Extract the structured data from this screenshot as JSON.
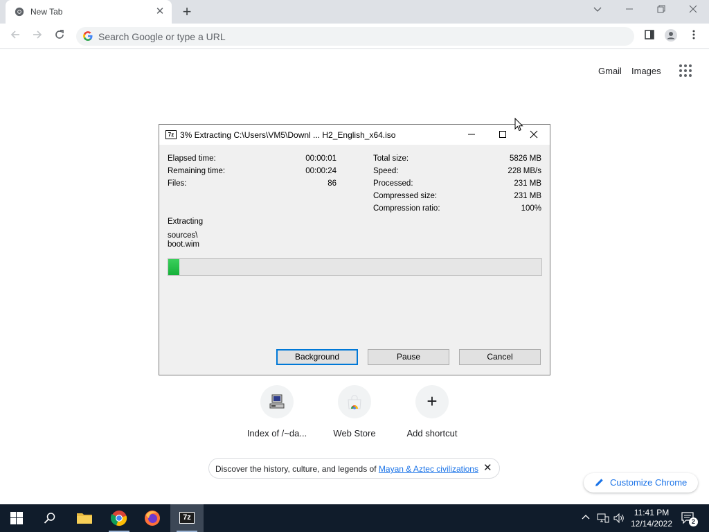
{
  "browser": {
    "tab_title": "New Tab",
    "tab_close": "✕",
    "new_tab": "+",
    "omnibox_placeholder": "Search Google or type a URL",
    "gmail": "Gmail",
    "images": "Images"
  },
  "shortcuts": [
    {
      "label": "Index of /~da..."
    },
    {
      "label": "Web Store"
    },
    {
      "label": "Add shortcut",
      "glyph": "+"
    }
  ],
  "promo": {
    "text": "Discover the history, culture, and legends of ",
    "link": "Mayan & Aztec civilizations",
    "close": "✕"
  },
  "customize": {
    "label": "Customize Chrome"
  },
  "dialog": {
    "icon": "7z",
    "title": "3% Extracting C:\\Users\\VM5\\Downl ... H2_English_x64.iso",
    "progress_fraction": 0.03,
    "stats_left": [
      {
        "label": "Elapsed time:",
        "value": "00:00:01"
      },
      {
        "label": "Remaining time:",
        "value": "00:00:24"
      },
      {
        "label": "Files:",
        "value": "86"
      }
    ],
    "stats_right": [
      {
        "label": "Total size:",
        "value": "5826 MB"
      },
      {
        "label": "Speed:",
        "value": "228 MB/s"
      },
      {
        "label": "Processed:",
        "value": "231 MB"
      },
      {
        "label": "Compressed size:",
        "value": "231 MB"
      },
      {
        "label": "Compression ratio:",
        "value": "100%"
      }
    ],
    "status": "Extracting",
    "path_line1": "sources\\",
    "path_line2": "boot.wim",
    "buttons": {
      "background": "Background",
      "pause": "Pause",
      "cancel": "Cancel"
    }
  },
  "taskbar": {
    "time": "11:41 PM",
    "date": "12/14/2022",
    "notification_count": "2",
    "sevenzip_label": "7z"
  },
  "colors": {
    "chrome_tabstrip": "#dee1e6",
    "accent_blue": "#1a73e8",
    "progress_green": "#16b13a",
    "taskbar": "#101c2b"
  }
}
